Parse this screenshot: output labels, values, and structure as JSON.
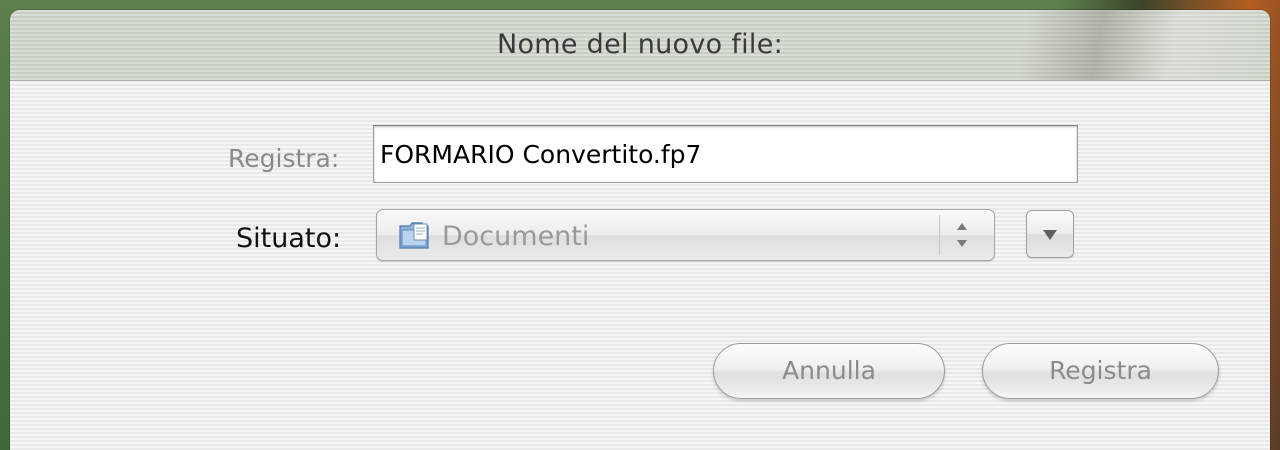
{
  "dialog": {
    "title": "Nome del nuovo file:"
  },
  "save_as": {
    "label": "Registra:",
    "value": "FORMARIO Convertito.fp7"
  },
  "where": {
    "label": "Situato:",
    "selected": "Documenti",
    "icon": "documents-folder-icon"
  },
  "buttons": {
    "cancel": "Annulla",
    "save": "Registra"
  },
  "colors": {
    "desktop": "#3f6b3a",
    "sheet_background": "#f1f1f1",
    "title_bar": "#cfd6cc",
    "disabled_text": "#8b8b8b"
  }
}
